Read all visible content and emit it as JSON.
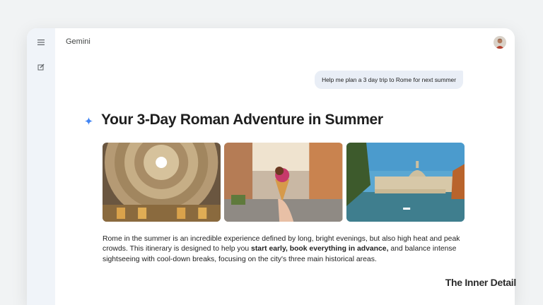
{
  "app": {
    "title": "Gemini"
  },
  "rail": {
    "menu_icon": "hamburger-menu-icon",
    "new_chat_icon": "edit-icon"
  },
  "conversation": {
    "user_prompt": "Help me plan a 3 day trip to Rome for next summer",
    "response": {
      "heading": "Your 3-Day Roman Adventure in Summer",
      "images": [
        "pantheon-dome-photo",
        "gelato-street-photo",
        "tiber-river-photo"
      ],
      "paragraph": {
        "part1": "Rome in the summer is an incredible experience defined by long, bright evenings, but also high heat and peak crowds. This itinerary is designed to help you ",
        "bold": "start early, book everything in advance,",
        "part2": " and balance intense sightseeing with cool-down breaks, focusing on the city's three main historical areas."
      }
    }
  },
  "watermark": "The Inner Detail",
  "colors": {
    "accent": "#4285f4",
    "rail_bg": "#f0f4f9",
    "bubble_bg": "#e9eef6"
  }
}
